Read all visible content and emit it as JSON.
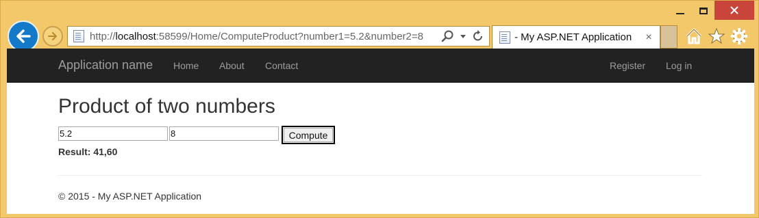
{
  "browser": {
    "url_prefix": "http://",
    "url_host": "localhost",
    "url_rest": ":58599/Home/ComputeProduct?number1=5.2&number2=8",
    "tab_title": "- My ASP.NET Application",
    "tab_close": "×"
  },
  "navbar": {
    "brand": "Application name",
    "links": [
      "Home",
      "About",
      "Contact"
    ],
    "right_links": [
      "Register",
      "Log in"
    ]
  },
  "main": {
    "title": "Product of two numbers",
    "number1_value": "5.2",
    "number2_value": "8",
    "compute_label": "Compute",
    "result_text": "Result: 41,60"
  },
  "footer": {
    "text": "© 2015 - My ASP.NET Application"
  },
  "colors": {
    "frame": "#f2c86a",
    "navbar_bg": "#222222",
    "nav_text": "#9d9d9d",
    "back_button": "#1479c9",
    "close_button": "#c9453c"
  }
}
